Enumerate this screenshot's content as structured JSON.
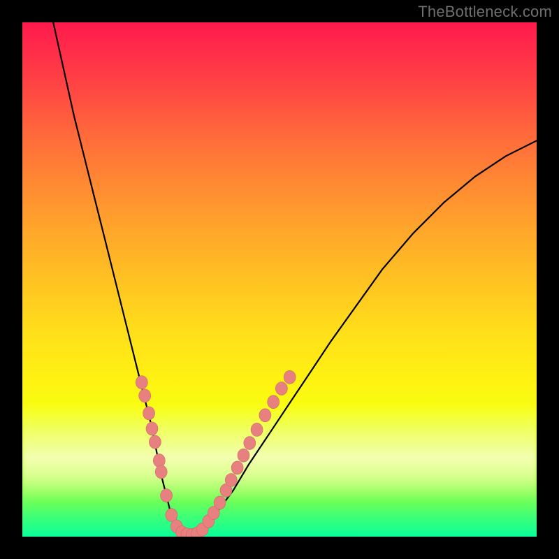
{
  "watermark": "TheBottleneck.com",
  "colors": {
    "background": "#000000",
    "gradient_top": "#ff1a4d",
    "gradient_bottom": "#0aff9a",
    "curve": "#000000",
    "marker_fill": "#e98080",
    "marker_stroke": "#c96a6a"
  },
  "chart_data": {
    "type": "line",
    "title": "",
    "xlabel": "",
    "ylabel": "",
    "xlim": [
      0,
      100
    ],
    "ylim": [
      0,
      100
    ],
    "grid": false,
    "legend": false,
    "annotations": [],
    "series": [
      {
        "name": "curve",
        "x": [
          6,
          8,
          10,
          12,
          14,
          16,
          18,
          20,
          22,
          24,
          25,
          26,
          27,
          28,
          29,
          30,
          32,
          34,
          36,
          38,
          41,
          44,
          48,
          52,
          56,
          60,
          65,
          70,
          76,
          82,
          88,
          94,
          100
        ],
        "y": [
          100,
          91,
          82,
          74,
          66,
          58,
          50,
          42,
          34,
          26,
          22,
          17,
          12,
          8,
          4,
          2,
          0,
          0,
          2,
          5,
          9,
          14,
          20,
          26,
          32,
          38,
          45,
          52,
          59,
          65,
          70,
          74,
          77
        ]
      }
    ],
    "markers": [
      {
        "x": 23.2,
        "y": 30.0
      },
      {
        "x": 23.8,
        "y": 27.4
      },
      {
        "x": 24.6,
        "y": 24.0
      },
      {
        "x": 25.2,
        "y": 21.0
      },
      {
        "x": 25.8,
        "y": 18.4
      },
      {
        "x": 26.6,
        "y": 14.8
      },
      {
        "x": 27.0,
        "y": 12.6
      },
      {
        "x": 28.0,
        "y": 8.0
      },
      {
        "x": 29.0,
        "y": 4.2
      },
      {
        "x": 30.0,
        "y": 2.0
      },
      {
        "x": 31.0,
        "y": 0.8
      },
      {
        "x": 32.0,
        "y": 0.4
      },
      {
        "x": 33.0,
        "y": 0.3
      },
      {
        "x": 34.0,
        "y": 0.6
      },
      {
        "x": 35.0,
        "y": 1.4
      },
      {
        "x": 36.2,
        "y": 3.0
      },
      {
        "x": 37.2,
        "y": 4.6
      },
      {
        "x": 38.4,
        "y": 6.6
      },
      {
        "x": 39.6,
        "y": 9.0
      },
      {
        "x": 40.6,
        "y": 11.0
      },
      {
        "x": 41.8,
        "y": 13.4
      },
      {
        "x": 43.0,
        "y": 15.8
      },
      {
        "x": 44.2,
        "y": 18.2
      },
      {
        "x": 45.6,
        "y": 20.8
      },
      {
        "x": 47.2,
        "y": 23.6
      },
      {
        "x": 48.8,
        "y": 26.2
      },
      {
        "x": 50.4,
        "y": 28.8
      },
      {
        "x": 52.0,
        "y": 31.0
      }
    ]
  }
}
